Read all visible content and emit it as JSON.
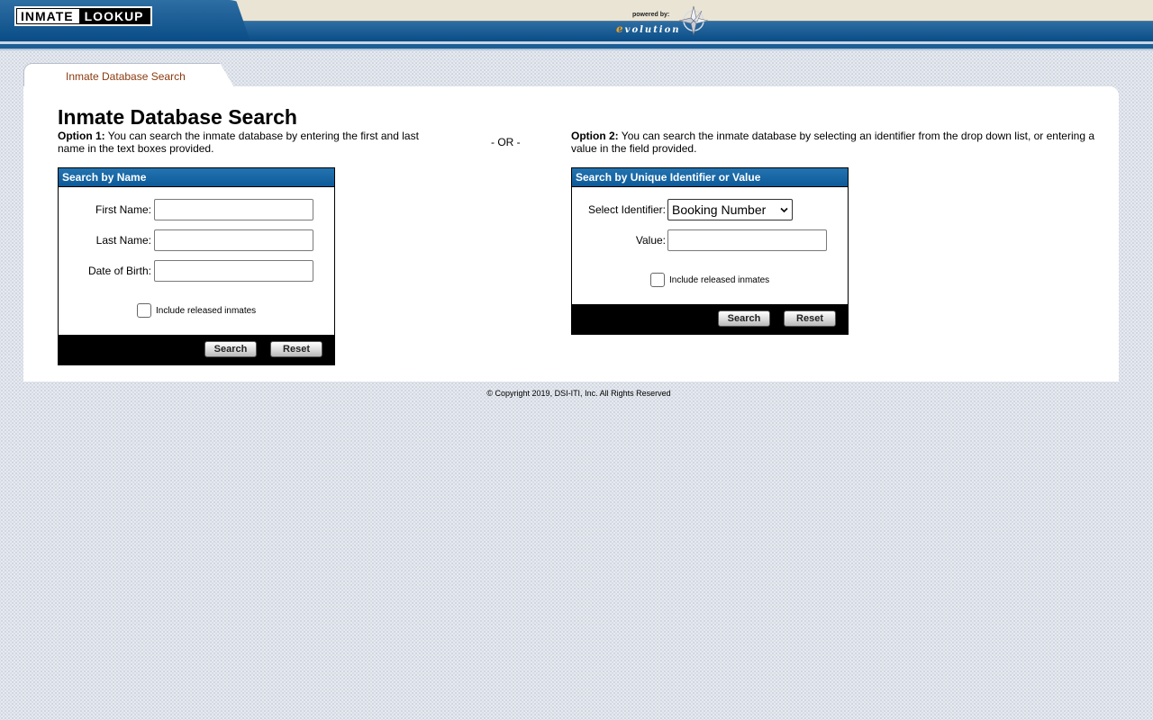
{
  "header": {
    "logo_inmate": "INMATE",
    "logo_lookup": "LOOKUP",
    "powered_by": "powered by:",
    "evolution_e": "e",
    "evolution_rest": "volution"
  },
  "tab": {
    "label": "Inmate Database Search"
  },
  "page": {
    "title": "Inmate Database Search",
    "option1_label": "Option 1:",
    "option1_text": " You can search the inmate database by entering the first and last name in the text boxes provided.",
    "or_text": "- OR -",
    "option2_label": "Option 2:",
    "option2_text": " You can search the inmate database by selecting an identifier from the drop down list, or entering a value in the field provided."
  },
  "name_search": {
    "header": "Search by Name",
    "first_name_label": "First Name:",
    "first_name_value": "",
    "last_name_label": "Last Name:",
    "last_name_value": "",
    "dob_label": "Date of Birth:",
    "dob_value": "",
    "include_released_label": "Include released inmates",
    "include_released_checked": false,
    "search_label": "Search",
    "reset_label": "Reset"
  },
  "id_search": {
    "header": "Search by Unique Identifier or Value",
    "select_label": "Select Identifier:",
    "select_value": "Booking Number",
    "value_label": "Value:",
    "value_value": "",
    "include_released_label": "Include released inmates",
    "include_released_checked": false,
    "search_label": "Search",
    "reset_label": "Reset"
  },
  "footer": {
    "copyright": "© Copyright 2019, DSI-ITI, Inc. All Rights Reserved"
  },
  "colors": {
    "header_blue": "#0a4c86",
    "header_beige": "#e9e4d4",
    "box_header_blue": "#0d5a99",
    "tab_text": "#8b3a0e"
  }
}
